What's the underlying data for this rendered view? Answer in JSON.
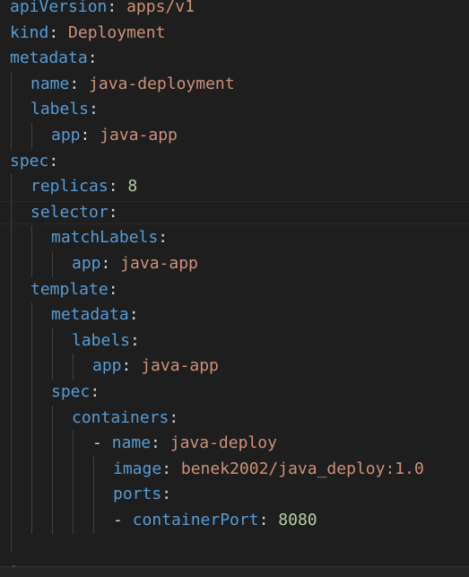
{
  "editor": {
    "colors": {
      "background": "#1e1e1e",
      "key": "#569cd6",
      "string_value": "#ce9178",
      "number_value": "#b5cea8",
      "punctuation": "#d4d4d4",
      "indent_guide": "#404040"
    },
    "current_line": 8,
    "lines": [
      {
        "indent": 0,
        "dash": false,
        "key": "apiVersion",
        "value": "apps/v1",
        "value_type": "string"
      },
      {
        "indent": 0,
        "dash": false,
        "key": "kind",
        "value": "Deployment",
        "value_type": "string"
      },
      {
        "indent": 0,
        "dash": false,
        "key": "metadata",
        "value": "",
        "value_type": "none"
      },
      {
        "indent": 1,
        "dash": false,
        "key": "name",
        "value": "java-deployment",
        "value_type": "string"
      },
      {
        "indent": 1,
        "dash": false,
        "key": "labels",
        "value": "",
        "value_type": "none"
      },
      {
        "indent": 2,
        "dash": false,
        "key": "app",
        "value": "java-app",
        "value_type": "string"
      },
      {
        "indent": 0,
        "dash": false,
        "key": "spec",
        "value": "",
        "value_type": "none"
      },
      {
        "indent": 1,
        "dash": false,
        "key": "replicas",
        "value": "8",
        "value_type": "number"
      },
      {
        "indent": 1,
        "dash": false,
        "key": "selector",
        "value": "",
        "value_type": "none"
      },
      {
        "indent": 2,
        "dash": false,
        "key": "matchLabels",
        "value": "",
        "value_type": "none"
      },
      {
        "indent": 3,
        "dash": false,
        "key": "app",
        "value": "java-app",
        "value_type": "string"
      },
      {
        "indent": 1,
        "dash": false,
        "key": "template",
        "value": "",
        "value_type": "none"
      },
      {
        "indent": 2,
        "dash": false,
        "key": "metadata",
        "value": "",
        "value_type": "none"
      },
      {
        "indent": 3,
        "dash": false,
        "key": "labels",
        "value": "",
        "value_type": "none"
      },
      {
        "indent": 4,
        "dash": false,
        "key": "app",
        "value": "java-app",
        "value_type": "string"
      },
      {
        "indent": 2,
        "dash": false,
        "key": "spec",
        "value": "",
        "value_type": "none"
      },
      {
        "indent": 3,
        "dash": false,
        "key": "containers",
        "value": "",
        "value_type": "none"
      },
      {
        "indent": 4,
        "dash": true,
        "key": "name",
        "value": "java-deploy",
        "value_type": "string"
      },
      {
        "indent": 5,
        "dash": false,
        "key": "image",
        "value": "benek2002/java_deploy:1.0",
        "value_type": "string"
      },
      {
        "indent": 5,
        "dash": false,
        "key": "ports",
        "value": "",
        "value_type": "none"
      },
      {
        "indent": 5,
        "dash": true,
        "key": "containerPort",
        "value": "8080",
        "value_type": "number"
      }
    ],
    "bottom_mark": "\""
  }
}
